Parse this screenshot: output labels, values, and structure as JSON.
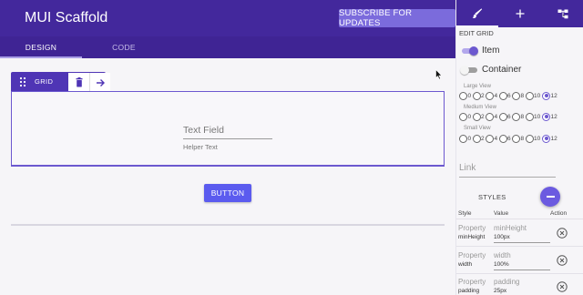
{
  "app": {
    "title": "MUI Scaffold",
    "subscribe_label": "SUBSCRIBE FOR UPDATES"
  },
  "tabs": [
    {
      "label": "DESIGN",
      "active": true
    },
    {
      "label": "CODE",
      "active": false
    }
  ],
  "canvas": {
    "grid_toolbar": {
      "label": "GRID",
      "icons": [
        "drag-handle-icon",
        "trash-icon",
        "arrow-right-icon"
      ]
    },
    "textfield": {
      "label": "Text Field",
      "helper": "Helper Text"
    },
    "button_label": "BUTTON"
  },
  "panel": {
    "tabs": [
      {
        "icon": "brush-icon",
        "active": true
      },
      {
        "icon": "plus-icon",
        "active": false
      },
      {
        "icon": "tree-icon",
        "active": false
      }
    ],
    "edit_grid_label": "EDIT GRID",
    "toggles": [
      {
        "label": "Item",
        "on": true
      },
      {
        "label": "Container",
        "on": false
      }
    ],
    "views": [
      {
        "label": "Large View",
        "options": [
          "0",
          "2",
          "4",
          "6",
          "8",
          "10",
          "12"
        ],
        "selected": "12"
      },
      {
        "label": "Medium View",
        "options": [
          "0",
          "2",
          "4",
          "6",
          "8",
          "10",
          "12"
        ],
        "selected": "12"
      },
      {
        "label": "Small View",
        "options": [
          "0",
          "2",
          "4",
          "6",
          "8",
          "10",
          "12"
        ],
        "selected": "12"
      }
    ],
    "link_placeholder": "Link",
    "styles_label": "STYLES",
    "table_headers": {
      "style": "Style",
      "value": "Value",
      "action": "Action"
    },
    "properties": [
      {
        "prop_label": "Property",
        "prop_name": "minHeight",
        "val_label": "minHeight",
        "val_value": "100px"
      },
      {
        "prop_label": "Property",
        "prop_name": "width",
        "val_label": "width",
        "val_value": "100%"
      },
      {
        "prop_label": "Property",
        "prop_name": "padding",
        "val_label": "padding",
        "val_value": "25px"
      }
    ]
  },
  "colors": {
    "appbar": "#43289c",
    "accent": "#6c58cf",
    "button": "#5b5bef",
    "fab": "#6b5ae0"
  }
}
